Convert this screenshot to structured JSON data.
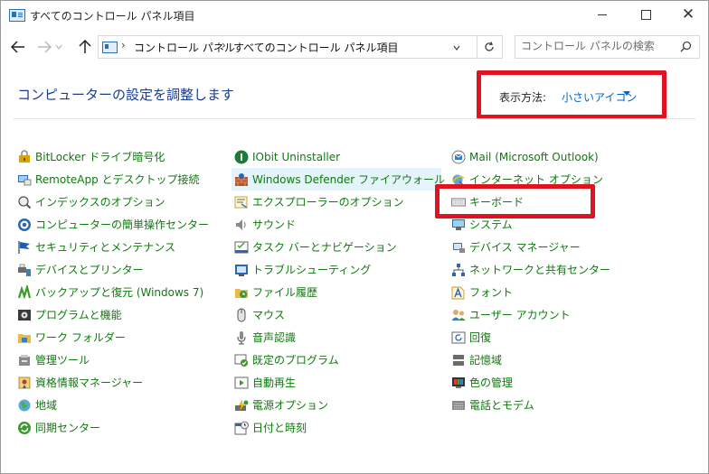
{
  "window": {
    "title": "すべてのコントロール パネル項目",
    "controls": {
      "minimize": "minimize-icon",
      "maximize": "maximize-icon",
      "close": "✕"
    }
  },
  "nav": {
    "breadcrumbs": [
      "コントロール パネル",
      "すべてのコントロール パネル項目"
    ],
    "search_placeholder": "コントロール パネルの検索"
  },
  "header": {
    "title": "コンピューターの設定を調整します",
    "view_label": "表示方法:",
    "view_value": "小さいアイコン"
  },
  "colors": {
    "link_green": "#0e7a0e",
    "title_blue": "#1a3d8f",
    "highlight_red": "#e0131f",
    "view_blue": "#0066cc"
  },
  "columns": [
    [
      {
        "label": "BitLocker ドライブ暗号化",
        "icon": "bitlocker-icon"
      },
      {
        "label": "RemoteApp とデスクトップ接続",
        "icon": "remoteapp-icon"
      },
      {
        "label": "インデックスのオプション",
        "icon": "indexing-icon"
      },
      {
        "label": "コンピューターの簡単操作センター",
        "icon": "ease-of-access-icon"
      },
      {
        "label": "セキュリティとメンテナンス",
        "icon": "flag-icon"
      },
      {
        "label": "デバイスとプリンター",
        "icon": "printer-icon"
      },
      {
        "label": "バックアップと復元 (Windows 7)",
        "icon": "backup-icon"
      },
      {
        "label": "プログラムと機能",
        "icon": "programs-icon"
      },
      {
        "label": "ワーク フォルダー",
        "icon": "work-folders-icon"
      },
      {
        "label": "管理ツール",
        "icon": "admin-tools-icon"
      },
      {
        "label": "資格情報マネージャー",
        "icon": "credential-icon"
      },
      {
        "label": "地域",
        "icon": "globe-icon"
      },
      {
        "label": "同期センター",
        "icon": "sync-icon"
      }
    ],
    [
      {
        "label": "IObit Uninstaller",
        "icon": "iobit-icon"
      },
      {
        "label": "Windows Defender ファイアウォール",
        "icon": "firewall-icon"
      },
      {
        "label": "エクスプローラーのオプション",
        "icon": "folder-options-icon"
      },
      {
        "label": "サウンド",
        "icon": "speaker-icon"
      },
      {
        "label": "タスク バーとナビゲーション",
        "icon": "taskbar-icon"
      },
      {
        "label": "トラブルシューティング",
        "icon": "troubleshoot-icon"
      },
      {
        "label": "ファイル履歴",
        "icon": "file-history-icon"
      },
      {
        "label": "マウス",
        "icon": "mouse-icon"
      },
      {
        "label": "音声認識",
        "icon": "microphone-icon"
      },
      {
        "label": "既定のプログラム",
        "icon": "default-programs-icon"
      },
      {
        "label": "自動再生",
        "icon": "autoplay-icon"
      },
      {
        "label": "電源オプション",
        "icon": "power-icon"
      },
      {
        "label": "日付と時刻",
        "icon": "clock-icon"
      }
    ],
    [
      {
        "label": "Mail (Microsoft Outlook)",
        "icon": "mail-icon"
      },
      {
        "label": "インターネット オプション",
        "icon": "internet-options-icon"
      },
      {
        "label": "キーボード",
        "icon": "keyboard-icon"
      },
      {
        "label": "システム",
        "icon": "system-icon"
      },
      {
        "label": "デバイス マネージャー",
        "icon": "device-manager-icon"
      },
      {
        "label": "ネットワークと共有センター",
        "icon": "network-icon"
      },
      {
        "label": "フォント",
        "icon": "font-icon"
      },
      {
        "label": "ユーザー アカウント",
        "icon": "user-accounts-icon"
      },
      {
        "label": "回復",
        "icon": "recovery-icon"
      },
      {
        "label": "記憶域",
        "icon": "storage-icon"
      },
      {
        "label": "色の管理",
        "icon": "color-management-icon"
      },
      {
        "label": "電話とモデム",
        "icon": "phone-modem-icon"
      }
    ]
  ]
}
